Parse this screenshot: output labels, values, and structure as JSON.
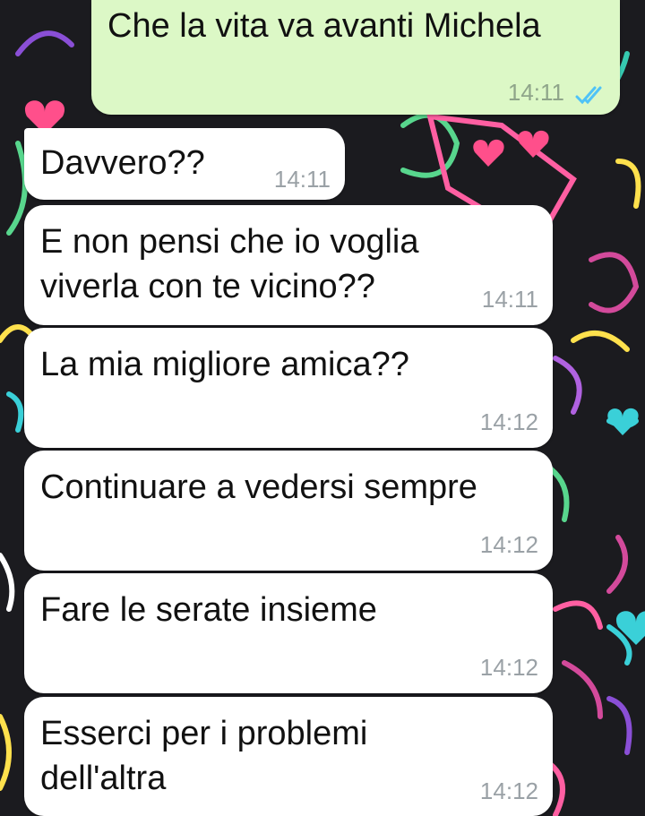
{
  "colors": {
    "outgoing_bubble": "#dcf8c6",
    "incoming_bubble": "#ffffff",
    "read_ticks": "#4fc3f7",
    "wallpaper": "#1b1b1f"
  },
  "messages": [
    {
      "direction": "outgoing",
      "text": "Che la vita va avanti Michela",
      "time": "14:11",
      "status_icon": "double-check-read-icon"
    },
    {
      "direction": "incoming",
      "text": "Davvero??",
      "time": "14:11"
    },
    {
      "direction": "incoming",
      "text": "E non pensi che io voglia\nviverla con te vicino??",
      "time": "14:11"
    },
    {
      "direction": "incoming",
      "text": "La mia migliore amica??",
      "time": "14:12"
    },
    {
      "direction": "incoming",
      "text": "Continuare a vedersi sempre",
      "time": "14:12"
    },
    {
      "direction": "incoming",
      "text": "Fare le serate insieme",
      "time": "14:12"
    },
    {
      "direction": "incoming",
      "text": "Esserci per i problemi\ndell'altra",
      "time": "14:12"
    }
  ]
}
